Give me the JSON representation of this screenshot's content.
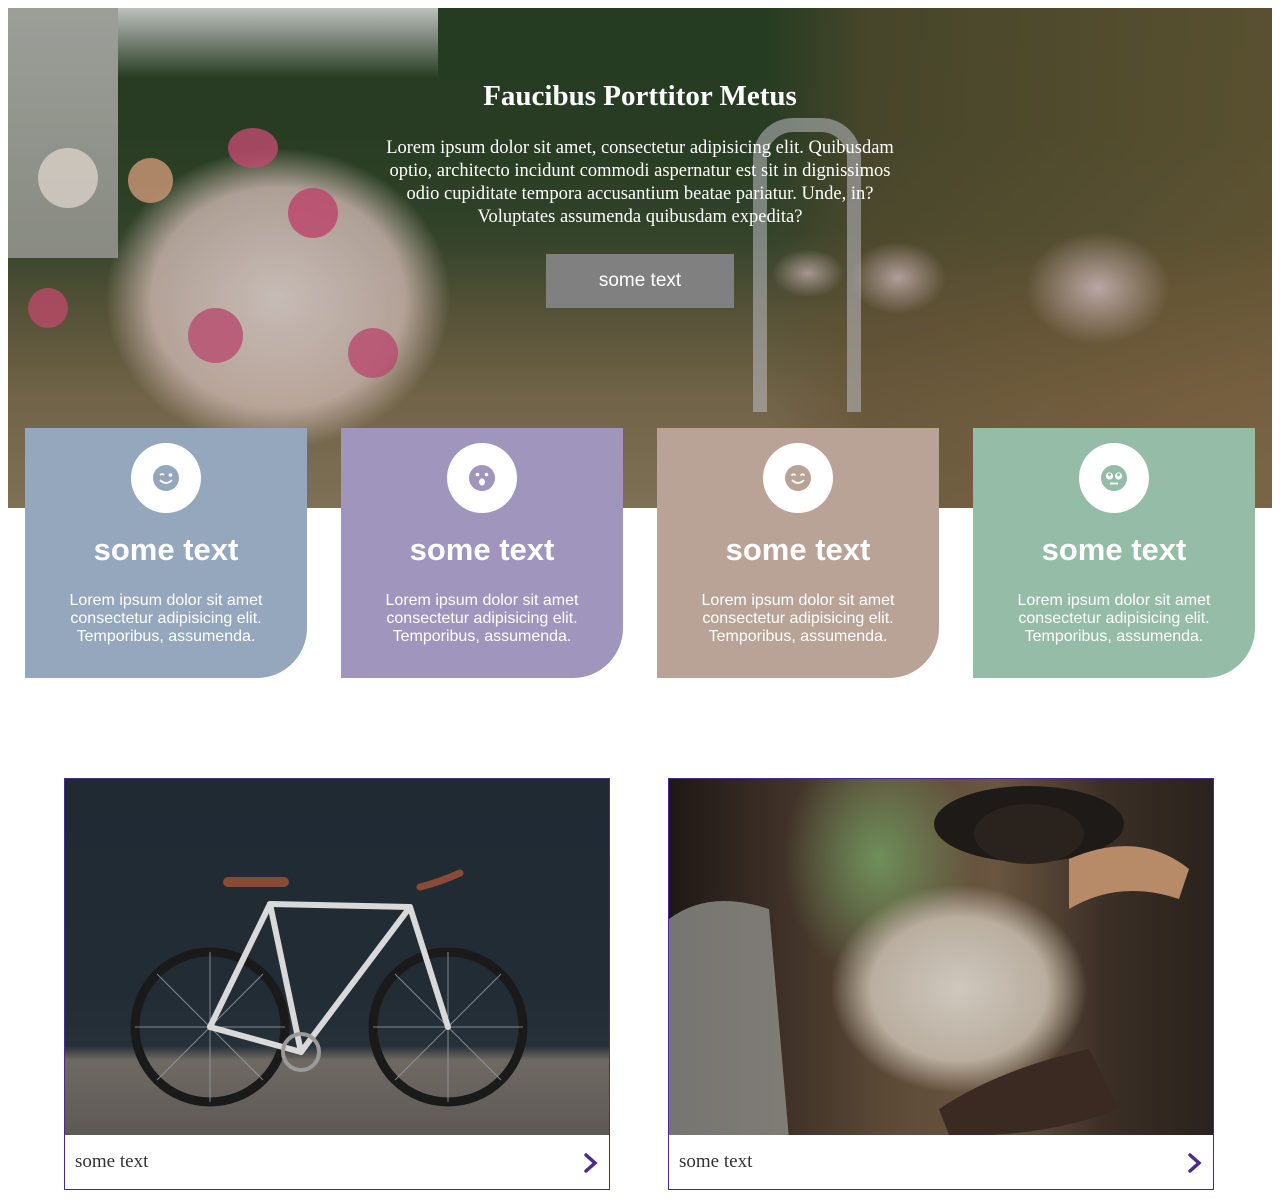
{
  "hero": {
    "title": "Faucibus Porttitor Metus",
    "text": "Lorem ipsum dolor sit amet, consectetur adipisicing elit. Quibusdam optio, architecto incidunt commodi aspernatur est sit in dignissimos odio cupiditate tempora accusantium beatae pariatur. Unde, in? Voluptates assumenda quibusdam expedita?",
    "button_label": "some text",
    "image": "wedding-bouquet-photo"
  },
  "cards": [
    {
      "icon": "wink-face-icon",
      "title": "some text",
      "text": "Lorem ipsum dolor sit amet consectetur adipisicing elit. Temporibus, assumenda.",
      "color": "#94a7bd"
    },
    {
      "icon": "surprised-face-icon",
      "title": "some text",
      "text": "Lorem ipsum dolor sit amet consectetur adipisicing elit. Temporibus, assumenda.",
      "color": "#9f95bd"
    },
    {
      "icon": "smile-face-icon",
      "title": "some text",
      "text": "Lorem ipsum dolor sit amet consectetur adipisicing elit. Temporibus, assumenda.",
      "color": "#b9a396"
    },
    {
      "icon": "rolling-eyes-face-icon",
      "title": "some text",
      "text": "Lorem ipsum dolor sit amet consectetur adipisicing elit. Temporibus, assumenda.",
      "color": "#95bca6"
    }
  ],
  "photo_cards": [
    {
      "image": "bicycle-photo",
      "caption": "some text",
      "arrow": "chevron-right-icon"
    },
    {
      "image": "man-in-car-photo",
      "caption": "some text",
      "arrow": "chevron-right-icon"
    }
  ],
  "colors": {
    "accent": "#4b2a8c",
    "button": "#808080"
  }
}
